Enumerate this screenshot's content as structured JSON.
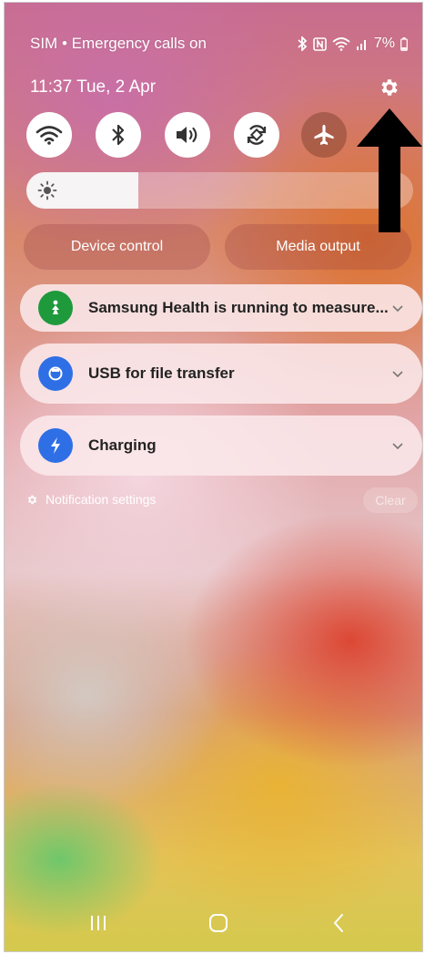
{
  "status_bar": {
    "carrier": "SIM • Emergency calls on",
    "battery": "7%"
  },
  "header": {
    "time_date": "11:37  Tue, 2 Apr",
    "settings_icon": "gear-icon"
  },
  "quick_toggles": [
    {
      "name": "wifi",
      "icon": "wifi-icon",
      "state": "on"
    },
    {
      "name": "bluetooth",
      "icon": "bluetooth-icon",
      "state": "on"
    },
    {
      "name": "sound",
      "icon": "speaker-icon",
      "state": "on"
    },
    {
      "name": "auto-rotate",
      "icon": "rotate-icon",
      "state": "on"
    },
    {
      "name": "airplane",
      "icon": "airplane-icon",
      "state": "off"
    }
  ],
  "brightness": {
    "level": 0.29,
    "icon": "sun-icon"
  },
  "controls": {
    "device_control": "Device control",
    "media_output": "Media output"
  },
  "notifications": [
    {
      "title": "Samsung Health is running to measure...",
      "icon": "samsung-health-icon",
      "color": "#1e9a3c"
    },
    {
      "title": "USB for file transfer",
      "icon": "usb-icon",
      "color": "#2f6fe6"
    },
    {
      "title": "Charging",
      "icon": "lightning-icon",
      "color": "#2f6fe6"
    }
  ],
  "notification_settings": "Notification settings",
  "clear_label": "Clear",
  "colors": {
    "accent_green": "#1e9a3c",
    "accent_blue": "#2f6fe6"
  }
}
